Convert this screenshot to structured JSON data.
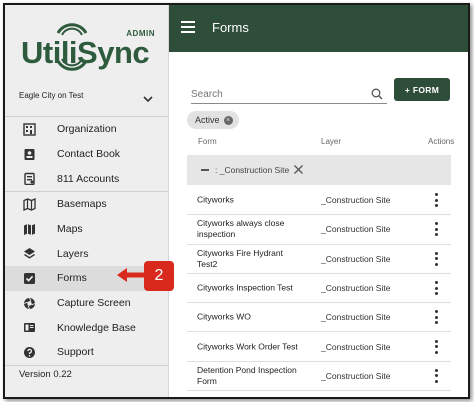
{
  "brand": {
    "wordmark": "UtiliSync",
    "admin_label": "ADMIN",
    "color": "#2e5b3e"
  },
  "workspace": {
    "name": "Eagle City on Test",
    "chevron_icon": "chevron-down-icon"
  },
  "sidebar": {
    "groups": [
      [
        {
          "label": "Organization",
          "icon": "building-icon"
        },
        {
          "label": "Contact Book",
          "icon": "contact-book-icon"
        },
        {
          "label": "811 Accounts",
          "icon": "clipboard-icon"
        }
      ],
      [
        {
          "label": "Basemaps",
          "icon": "map-outline-icon"
        },
        {
          "label": "Maps",
          "icon": "map-icon"
        },
        {
          "label": "Layers",
          "icon": "layers-icon"
        },
        {
          "label": "Forms",
          "icon": "checkbox-icon",
          "active": true
        },
        {
          "label": "Capture Screen",
          "icon": "camera-shutter-icon"
        },
        {
          "label": "Knowledge Base",
          "icon": "book-icon"
        },
        {
          "label": "Support",
          "icon": "help-circle-icon"
        }
      ]
    ],
    "version": "Version 0.22"
  },
  "topbar": {
    "title": "Forms",
    "menu_icon": "hamburger-icon",
    "color": "#2e4e3a"
  },
  "search": {
    "placeholder": "Search",
    "value": ""
  },
  "add_form_button": "+ FORM",
  "filter_chip": "Active",
  "table": {
    "headers": {
      "form": "Form",
      "layer": "Layer",
      "actions": "Actions"
    },
    "group_label": ": _Construction Site",
    "rows": [
      {
        "form": "Cityworks",
        "layer": "_Construction Site"
      },
      {
        "form": "Cityworks always close inspection",
        "layer": "_Construction Site"
      },
      {
        "form": "Cityworks Fire Hydrant Test2",
        "layer": "_Construction Site"
      },
      {
        "form": "Cityworks Inspection Test",
        "layer": "_Construction Site"
      },
      {
        "form": "Cityworks WO",
        "layer": "_Construction Site"
      },
      {
        "form": "Cityworks Work Order Test",
        "layer": "_Construction Site"
      },
      {
        "form": "Detention Pond Inspection Form",
        "layer": "_Construction Site"
      }
    ]
  },
  "callout": {
    "number": "2",
    "color": "#d9291c"
  }
}
